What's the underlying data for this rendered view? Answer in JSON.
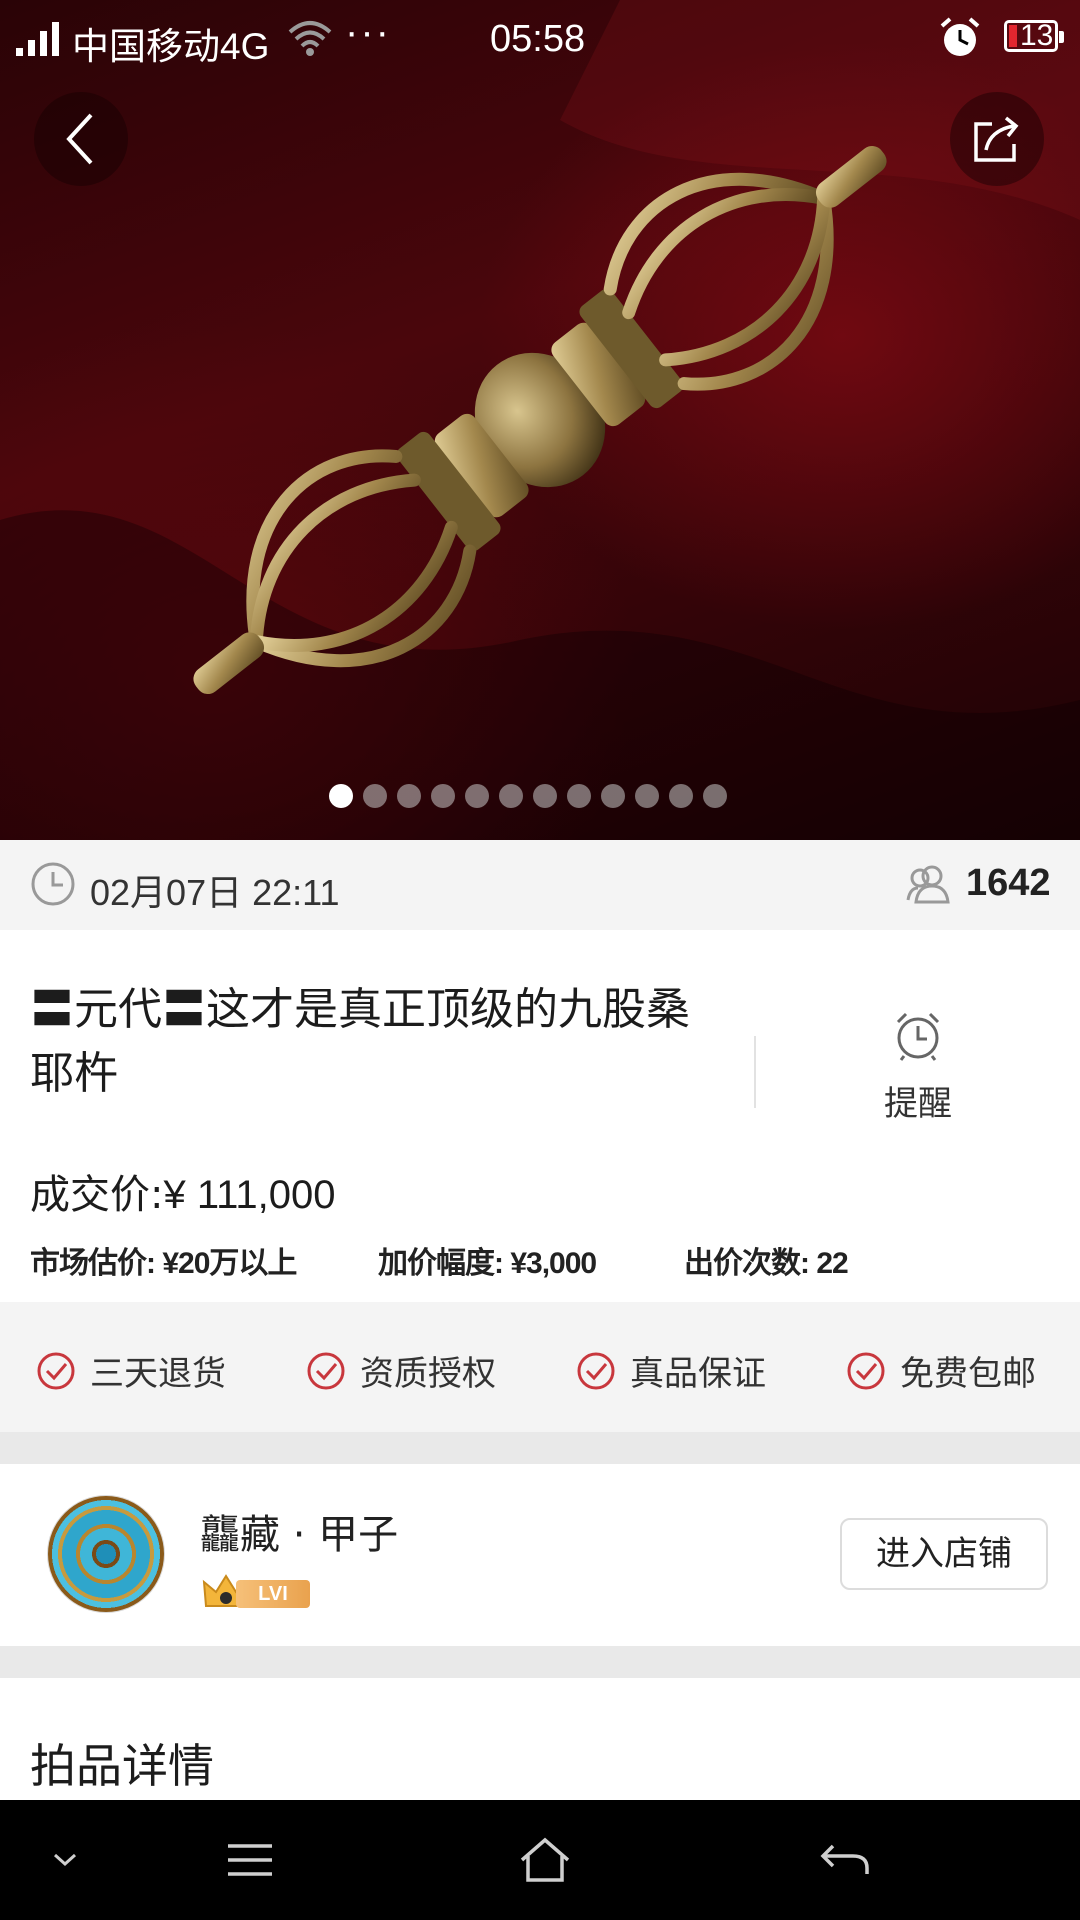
{
  "status_bar": {
    "carrier": "中国移动4G",
    "more": "···",
    "time": "05:58",
    "battery": "13"
  },
  "gallery": {
    "total_images": 12,
    "active_index": 0
  },
  "info_bar": {
    "datetime": "02月07日 22:11",
    "viewer_count": "1642"
  },
  "item": {
    "title": "〓元代〓这才是真正顶级的九股桑耶杵",
    "remind_label": "提醒",
    "price_label": "成交价:",
    "price_value": "¥ 111,000",
    "market_estimate": "市场估价: ¥20万以上",
    "bid_increment": "加价幅度: ¥3,000",
    "bid_count": "出价次数: 22"
  },
  "guarantees": [
    "三天退货",
    "资质授权",
    "真品保证",
    "免费包邮"
  ],
  "shop": {
    "name": "龘藏 · 甲子",
    "level": "LVI",
    "enter_label": "进入店铺"
  },
  "detail_heading": "拍品详情",
  "colors": {
    "accent_red": "#c8373d",
    "background_gray": "#f4f4f4"
  }
}
